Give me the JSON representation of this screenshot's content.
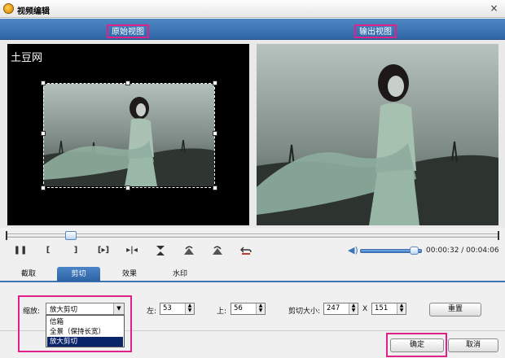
{
  "window": {
    "title": "视频编辑",
    "close_glyph": "×"
  },
  "views": {
    "original_label": "原始视图",
    "output_label": "输出视图",
    "watermark_text": "土豆网"
  },
  "transport": {
    "play": "❚❚",
    "mark_in": "[",
    "mark_out": "]",
    "next_frame": "[▸]",
    "prev_frame": "▸|◂",
    "time_display": "00:00:32 / 00:04:06",
    "playback_position": 0.13,
    "volume_level": 0.88
  },
  "tabs": [
    {
      "label": "截取"
    },
    {
      "label": "剪切"
    },
    {
      "label": "效果"
    },
    {
      "label": "水印"
    }
  ],
  "crop": {
    "zoom_label": "缩放:",
    "zoom_selected": "放大剪切",
    "zoom_options": [
      "信箱",
      "全景（保持长宽）",
      "放大剪切"
    ],
    "left_label": "左:",
    "left_value": "53",
    "top_label": "上:",
    "top_value": "56",
    "size_label": "剪切大小:",
    "width_value": "247",
    "x_label": "X",
    "height_value": "151",
    "reset_label": "重置"
  },
  "footer": {
    "ok_label": "确定",
    "cancel_label": "取消"
  },
  "colors": {
    "accent": "#2f66a6",
    "highlight": "#e0218a"
  }
}
